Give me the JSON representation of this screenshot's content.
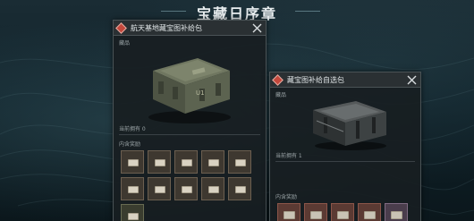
{
  "page_title": "宝藏日序章",
  "panel_left": {
    "title": "航天基地藏宝图补给包",
    "items_label": "藏品",
    "owned_label": "当前拥有 0",
    "rewards_label": "内含奖励"
  },
  "panel_right": {
    "title": "藏宝图补给自选包",
    "items_label": "藏品",
    "owned_label": "当前拥有 1",
    "rewards_label": "内含奖励"
  },
  "colors": {
    "accent": "#c5483c",
    "panel_bg": "#181e21",
    "slot_brown": "#3e3830",
    "slot_red": "#5b3a33"
  },
  "icons": {
    "panel_marker": "diamond-icon",
    "close": "close-icon",
    "reward_item": "document-icon"
  }
}
